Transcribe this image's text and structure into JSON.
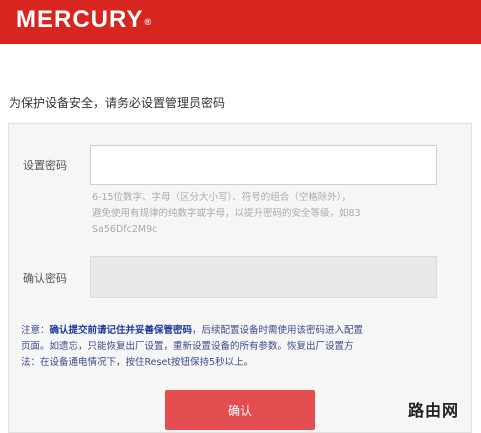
{
  "header": {
    "brand": "MERCURY",
    "brand_mark": "®",
    "bg_color": "#d7251f"
  },
  "page": {
    "heading": "为保护设备安全，请务必设置管理员密码"
  },
  "form": {
    "password_label": "设置密码",
    "password_value": "",
    "password_hint_line1": "6-15位数字、字母（区分大小写）、符号的组合（空格除外），",
    "password_hint_line2": "避免使用有规律的纯数字或字母，以提升密码的安全等级，如83",
    "password_hint_line3": "Sa56Dfc2M9c",
    "confirm_label": "确认密码",
    "confirm_value": ""
  },
  "notice": {
    "prefix": "注意：",
    "emphasis": "确认提交前请记住并妥善保管密码",
    "line1_rest": "，后续配置设备时需使用该密码进入配置",
    "line2": "页面。如遗忘，只能恢复出厂设置，重新设置设备的所有参数。恢复出厂设置方",
    "line3": "法：在设备通电情况下，按住Reset按钮保持5秒以上。"
  },
  "actions": {
    "confirm_label": "确认",
    "button_color": "#e34d4f"
  },
  "watermark": {
    "text": "路由网"
  }
}
